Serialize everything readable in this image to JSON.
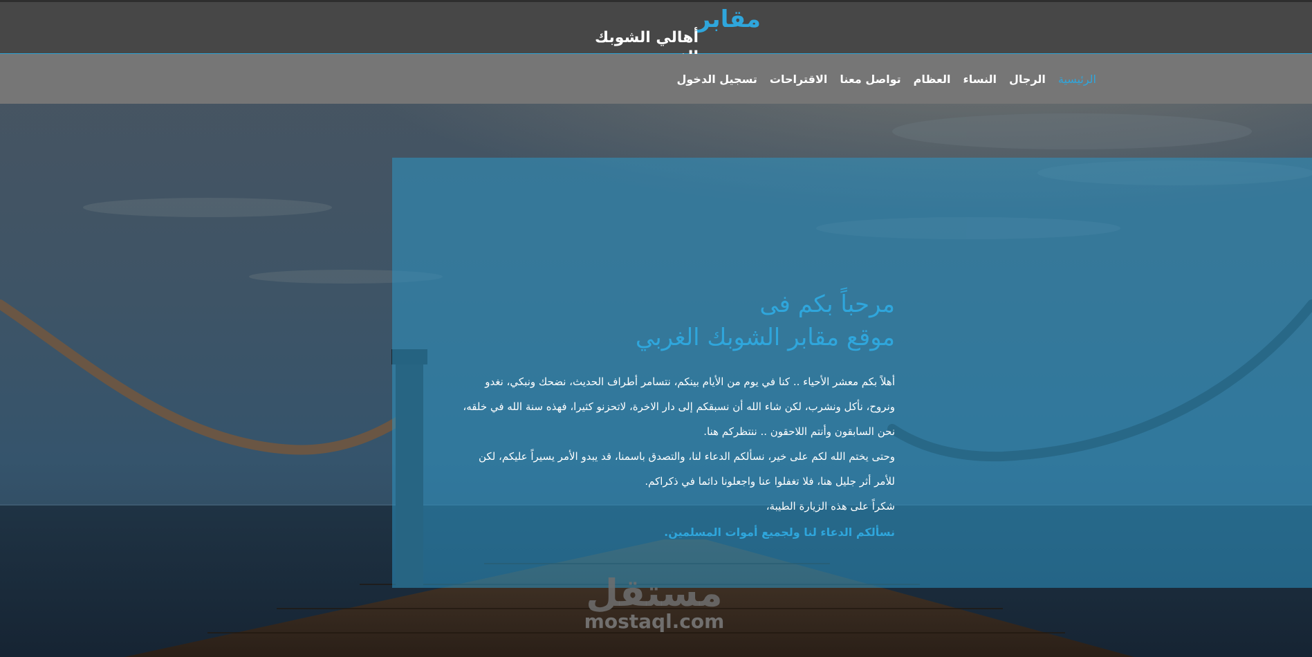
{
  "header": {
    "brand_main": "مقابر",
    "brand_sub": "أهالي الشوبك الغربي"
  },
  "nav": {
    "items": [
      {
        "label": "الرئيسية",
        "active": true
      },
      {
        "label": "الرجال",
        "active": false
      },
      {
        "label": "النساء",
        "active": false
      },
      {
        "label": "العظام",
        "active": false
      },
      {
        "label": "تواصل معنا",
        "active": false
      },
      {
        "label": "الاقتراحات",
        "active": false
      },
      {
        "label": "تسجيل الدخول",
        "active": false
      }
    ]
  },
  "welcome": {
    "title_line1": "مرحباً بكم فى",
    "title_line2": "موقع مقابر الشوبك الغربي",
    "body_lines": [
      "أهلاً بكم معشر الأحياء .. كنا في يوم من الأيام بينكم، نتسامر أطراف الحديث، نضحك ونبكي، نغدو",
      "ونروح، نأكل ونشرب، لكن شاء الله أن نسبقكم إلى دار الاخرة، لاتحزنو كثيرا، فهذه سنة الله في خلقه،",
      "نحن السابقون وأنتم اللاحقون .. ننتظركم هنا.",
      "وحتى يختم الله لكم على خير، نسألكم الدعاء لنا، والتصدق باسمنا، قد يبدو الأمر يسيراً عليكم، لكن",
      "للأمر أثر جليل هنا، فلا تغفلوا عنا واجعلونا دائما في ذكراكم.",
      "شكراً على هذه الزيارة الطيبة،"
    ],
    "closing": "نسألكم الدعاء لنا ولجميع أموات المسلمين."
  },
  "watermark": {
    "arabic": "مستقل",
    "latin": "mostaql.com"
  },
  "colors": {
    "accent": "#2fa6dc",
    "header_bg": "#474747",
    "nav_bg": "#767676",
    "panel_overlay": "rgba(46,150,196,0.55)"
  }
}
